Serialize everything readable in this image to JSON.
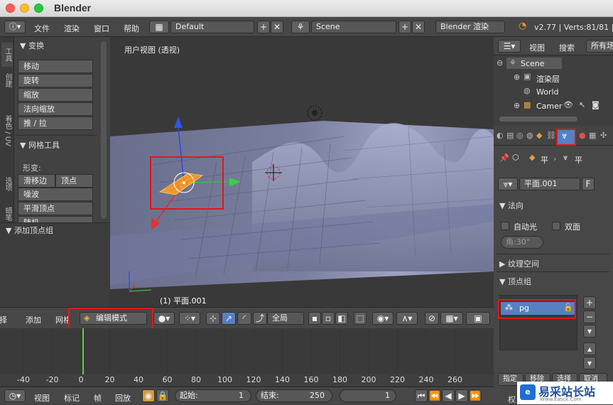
{
  "window": {
    "title": "Blender"
  },
  "topbar": {
    "menus": [
      "文件",
      "渲染",
      "窗口",
      "帮助"
    ],
    "layout": "Default",
    "scene": "Scene",
    "engine": "Blender 渲染",
    "stats": "v2.77 | Verts:81/81 |"
  },
  "tool_tabs": [
    "工具",
    "创建",
    "着色 / UV",
    "选项",
    "蜡笔"
  ],
  "transform": {
    "title": "变换",
    "buttons": [
      "移动",
      "旋转",
      "缩放",
      "法向缩放",
      "推 / 拉"
    ]
  },
  "mesh_tools": {
    "title": "网格工具",
    "deform_label": "形变:",
    "buttons": [
      "滑移边",
      "顶点",
      "噪波",
      "平滑顶点",
      "随机"
    ]
  },
  "operator_panel": {
    "title": "添加顶点组"
  },
  "viewport": {
    "view_label": "用户视图 (透视)",
    "object_label": "(1) 平面.001"
  },
  "viewport_header": {
    "select": "选择",
    "add": "添加",
    "mesh": "网格",
    "mode": "编辑模式",
    "pivot": "全局"
  },
  "timeline": {
    "ticks": [
      "-40",
      "-20",
      "0",
      "20",
      "40",
      "60",
      "80",
      "100",
      "120",
      "140",
      "160",
      "180",
      "200",
      "220",
      "240",
      "260"
    ]
  },
  "bottombar": {
    "menus": [
      "视图",
      "标记",
      "帧",
      "回放"
    ],
    "start_label": "起始:",
    "start_value": "1",
    "end_label": "结束:",
    "end_value": "250",
    "current": "1"
  },
  "outliner": {
    "menus": [
      "视图",
      "搜索"
    ],
    "filter": "所有场",
    "items": [
      "Scene",
      "渲染层",
      "World",
      "Camer"
    ]
  },
  "properties": {
    "breadcrumb1": "平",
    "breadcrumb2": "平",
    "mesh_name": "平面.001",
    "fake_user": "F",
    "normals_title": "法向",
    "auto_smooth": "自动光",
    "double_sided": "双面",
    "angle": "角:30°",
    "texspace_title": "纹理空间",
    "vgroups_title": "顶点组",
    "vgroup_name": "pg",
    "assign_partial": "指定",
    "remove_partial": "移除",
    "select_partial": "选择",
    "deselect_partial": "取消",
    "weight_partial": "权"
  },
  "watermark": {
    "text": "易采站长站",
    "sub": "Www.Easck.Com"
  },
  "colors": {
    "accent": "#5680c2",
    "highlight_red": "#e01818",
    "selected_orange": "#f29a2e"
  }
}
